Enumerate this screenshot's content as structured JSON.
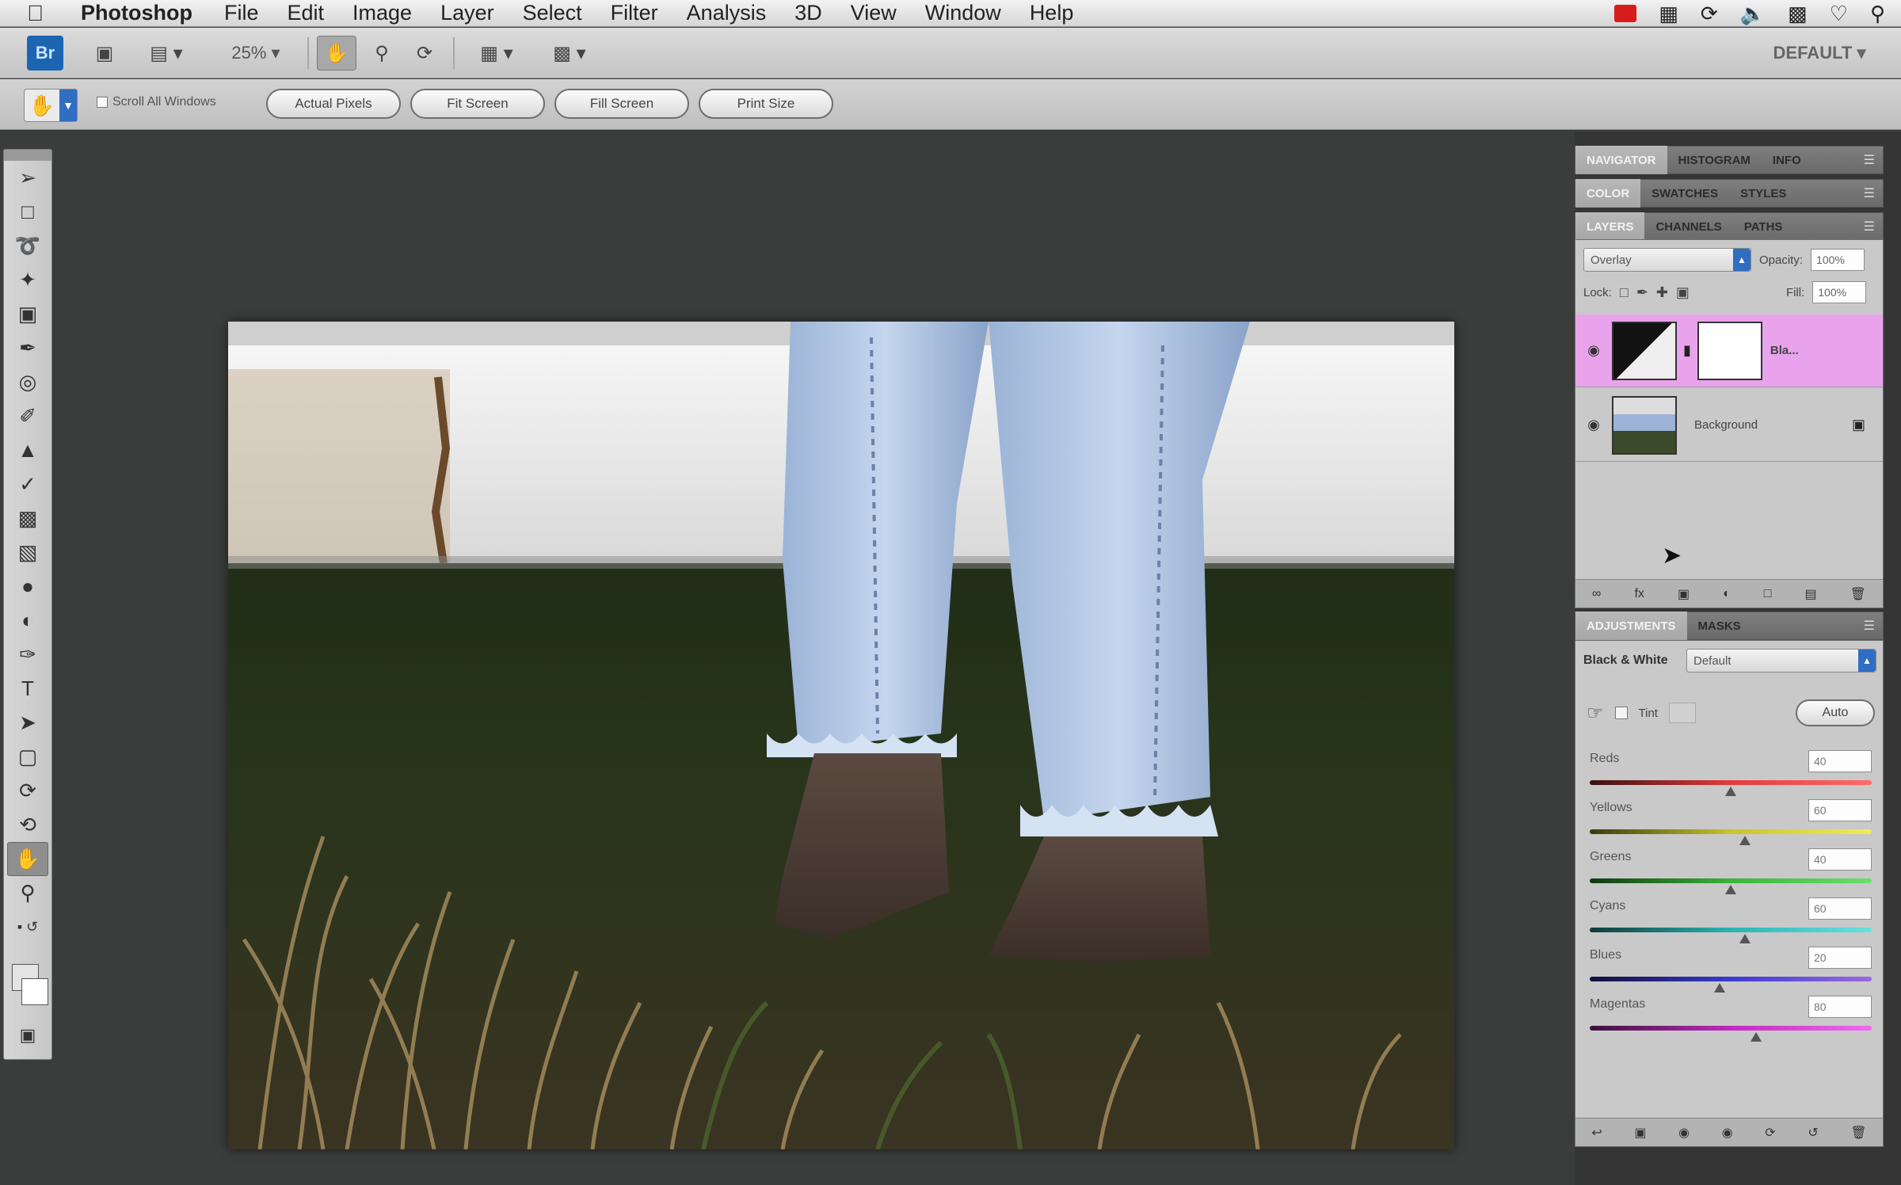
{
  "menubar": {
    "app_name": "Photoshop",
    "items": [
      "File",
      "Edit",
      "Image",
      "Layer",
      "Select",
      "Filter",
      "Analysis",
      "3D",
      "View",
      "Window",
      "Help"
    ]
  },
  "appbar": {
    "logo": "Br",
    "zoom": "25%",
    "workspace": "DEFAULT"
  },
  "options": {
    "scroll_all": "Scroll All Windows",
    "buttons": [
      "Actual Pixels",
      "Fit Screen",
      "Fill Screen",
      "Print Size"
    ]
  },
  "panels": {
    "group1_tabs": [
      "NAVIGATOR",
      "HISTOGRAM",
      "INFO"
    ],
    "group2_tabs": [
      "COLOR",
      "SWATCHES",
      "STYLES"
    ],
    "group3_tabs": [
      "LAYERS",
      "CHANNELS",
      "PATHS"
    ],
    "adjust_tabs": [
      "ADJUSTMENTS",
      "MASKS"
    ]
  },
  "layers": {
    "blend_mode": "Overlay",
    "opacity_label": "Opacity:",
    "opacity": "100%",
    "lock_label": "Lock:",
    "fill_label": "Fill:",
    "fill": "100%",
    "items": [
      {
        "name": "Bla...",
        "selected": true
      },
      {
        "name": "Background",
        "selected": false
      }
    ]
  },
  "adjustments": {
    "type_label": "Black & White",
    "preset": "Default",
    "tint_label": "Tint",
    "auto_label": "Auto",
    "sliders": [
      {
        "name": "Reds",
        "value": "40",
        "pct": 0.5,
        "gradient": "linear-gradient(90deg,#3a1010,#e63a3a,#ff6a6a)"
      },
      {
        "name": "Yellows",
        "value": "60",
        "pct": 0.55,
        "gradient": "linear-gradient(90deg,#3a3a10,#c9c42a,#f0ec5a)"
      },
      {
        "name": "Greens",
        "value": "40",
        "pct": 0.5,
        "gradient": "linear-gradient(90deg,#103a10,#3ab43a,#6ae06a)"
      },
      {
        "name": "Cyans",
        "value": "60",
        "pct": 0.55,
        "gradient": "linear-gradient(90deg,#103a3a,#2ab4b4,#6ae0e0)"
      },
      {
        "name": "Blues",
        "value": "20",
        "pct": 0.46,
        "gradient": "linear-gradient(90deg,#10103a,#3a3ad0,#9a6ae0)"
      },
      {
        "name": "Magentas",
        "value": "80",
        "pct": 0.59,
        "gradient": "linear-gradient(90deg,#3a103a,#c02ac0,#f06af0)"
      }
    ]
  },
  "colors": {
    "selected_layer": "#e8a3ec",
    "accent_blue": "#2f6ec1"
  }
}
